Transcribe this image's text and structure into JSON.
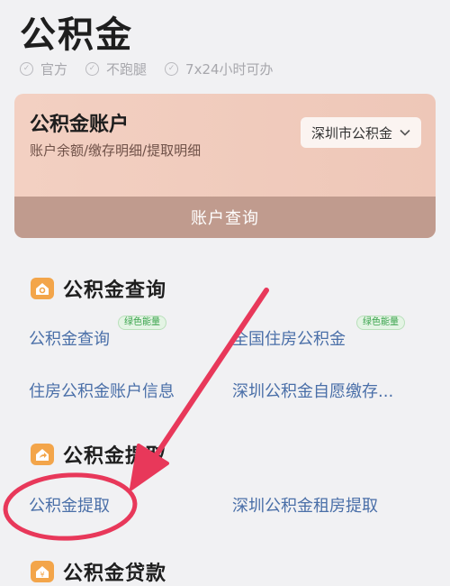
{
  "header": {
    "title": "公积金",
    "badges": [
      "官方",
      "不跑腿",
      "7x24小时可办"
    ]
  },
  "account_card": {
    "title": "公积金账户",
    "subtitle": "账户余额/缴存明细/提取明细",
    "city_select": "深圳市公积金",
    "query_button": "账户查询"
  },
  "sections": [
    {
      "title": "公积金查询",
      "icon": "house-search-icon",
      "items": [
        {
          "label": "公积金查询",
          "tag": "绿色能量"
        },
        {
          "label": "全国住房公积金",
          "tag": "绿色能量"
        },
        {
          "label": "住房公积金账户信息"
        },
        {
          "label": "深圳公积金自愿缴存..."
        }
      ]
    },
    {
      "title": "公积金提取",
      "icon": "house-share-icon",
      "items": [
        {
          "label": "公积金提取"
        },
        {
          "label": "深圳公积金租房提取"
        }
      ]
    },
    {
      "title": "公积金贷款",
      "icon": "yen-house-icon",
      "items": []
    }
  ],
  "annotation": {
    "color": "#e8385a"
  }
}
